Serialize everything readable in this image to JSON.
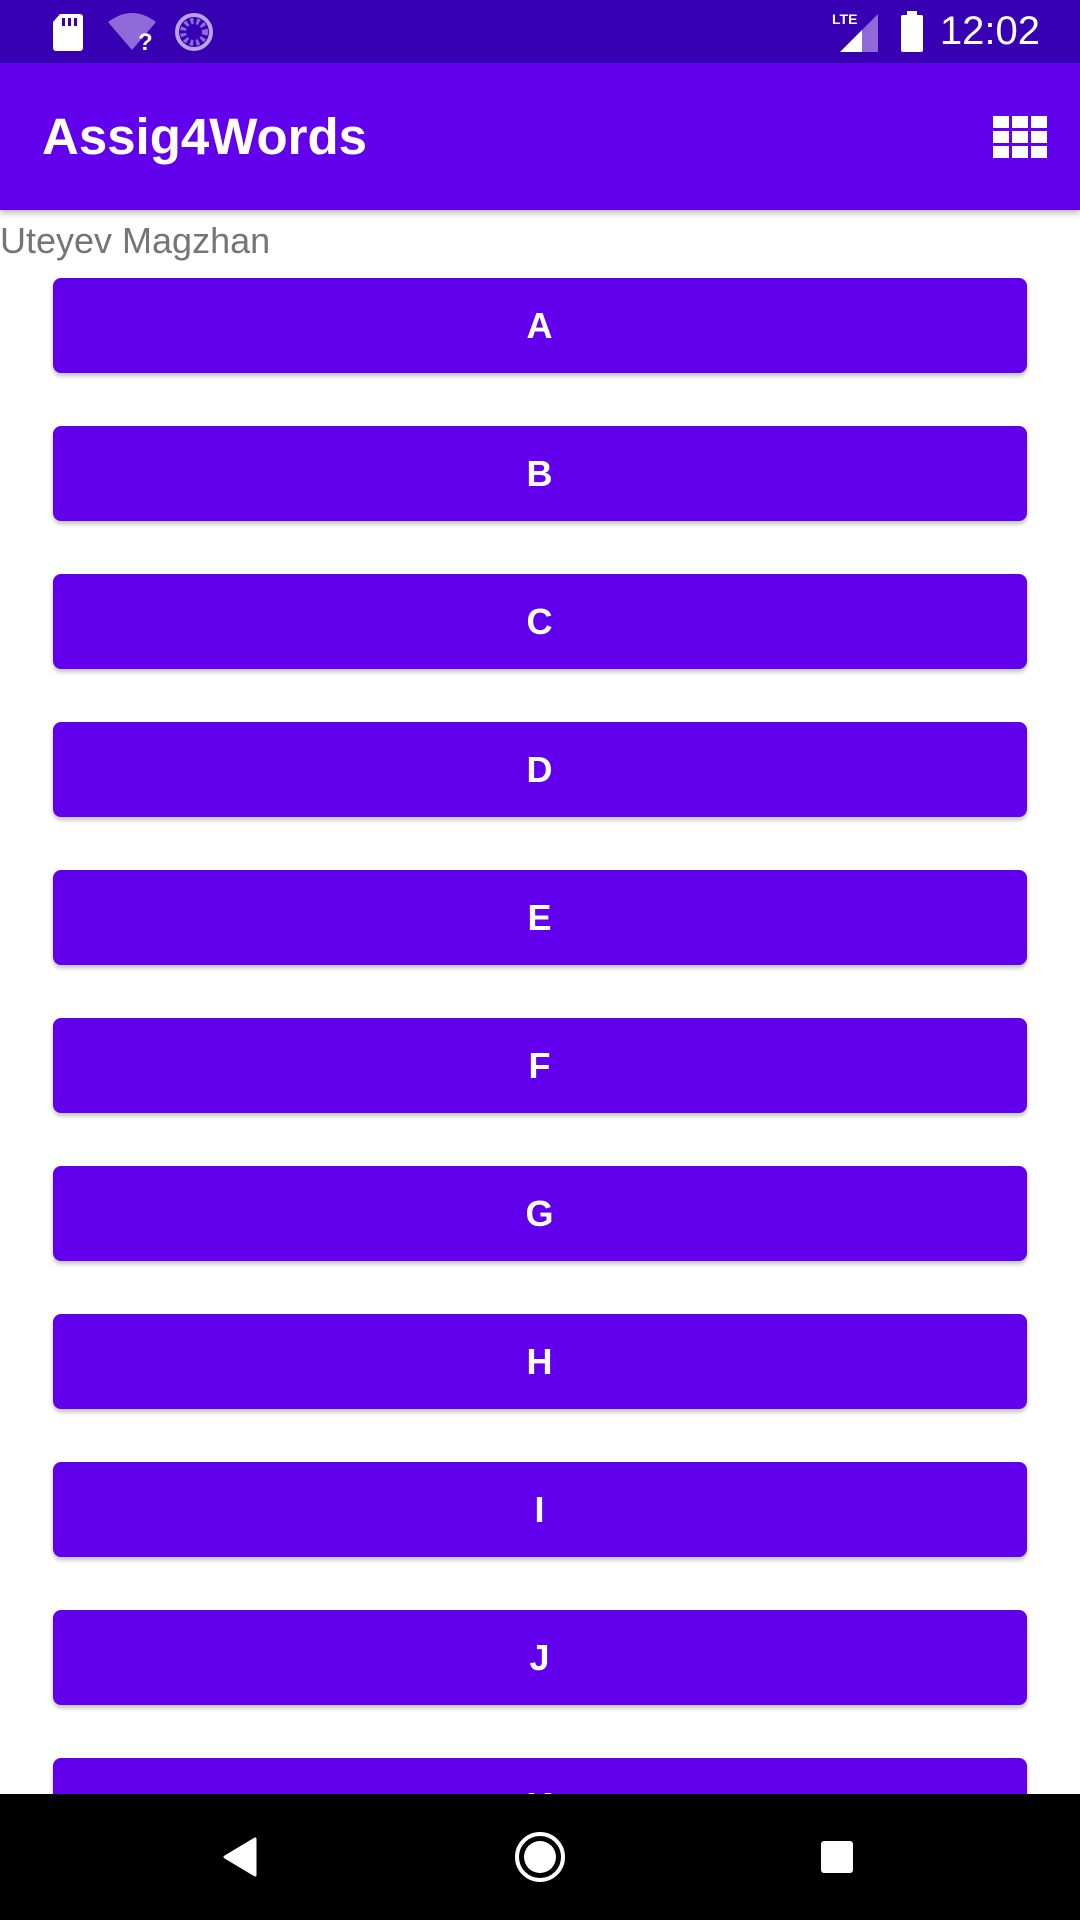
{
  "status_bar": {
    "time": "12:02",
    "network_label": "LTE",
    "icons": [
      "sd-card-icon",
      "wifi-unknown-icon",
      "sync-icon",
      "signal-icon",
      "battery-icon"
    ]
  },
  "app_bar": {
    "title": "Assig4Words",
    "action_icon": "grid-view-icon"
  },
  "content": {
    "author": "Uteyev Magzhan",
    "letters": [
      "A",
      "B",
      "C",
      "D",
      "E",
      "F",
      "G",
      "H",
      "I",
      "J",
      "K"
    ]
  },
  "nav_bar": {
    "icons": [
      "back-icon",
      "home-icon",
      "recents-icon"
    ]
  },
  "colors": {
    "status_bar": "#3700b3",
    "primary": "#6200ee",
    "author_text": "#757575",
    "nav_bar": "#000000"
  }
}
